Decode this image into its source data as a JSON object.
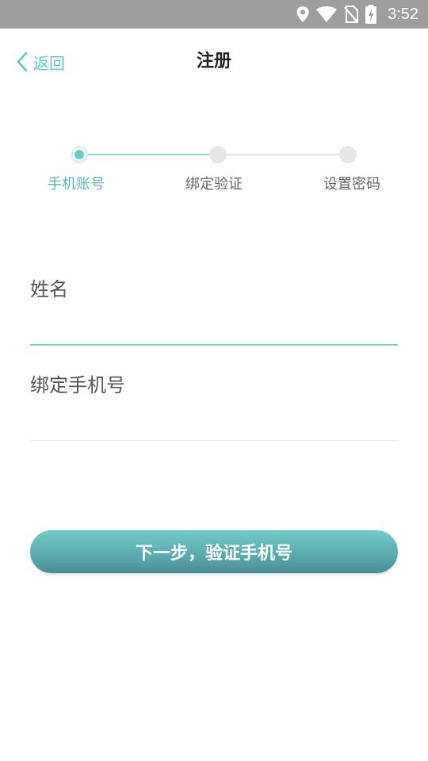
{
  "status_bar": {
    "time": "3:52",
    "icons": [
      "location-icon",
      "wifi-icon",
      "no-sim-icon",
      "battery-charging-icon"
    ]
  },
  "nav": {
    "back_label": "返回",
    "title": "注册"
  },
  "stepper": {
    "current_step": 1,
    "steps": [
      {
        "label": "手机账号",
        "active": true
      },
      {
        "label": "绑定验证",
        "active": false
      },
      {
        "label": "设置密码",
        "active": false
      }
    ]
  },
  "form": {
    "name_label": "姓名",
    "name_value": "",
    "phone_label": "绑定手机号",
    "phone_value": ""
  },
  "primary_action": {
    "label": "下一步，验证手机号"
  },
  "colors": {
    "accent": "#5ec4c2",
    "status_bar": "#9e9e9e",
    "button_top": "#72cbc6",
    "button_bottom": "#4a8c96",
    "inactive_dot": "#e6e6e6"
  }
}
